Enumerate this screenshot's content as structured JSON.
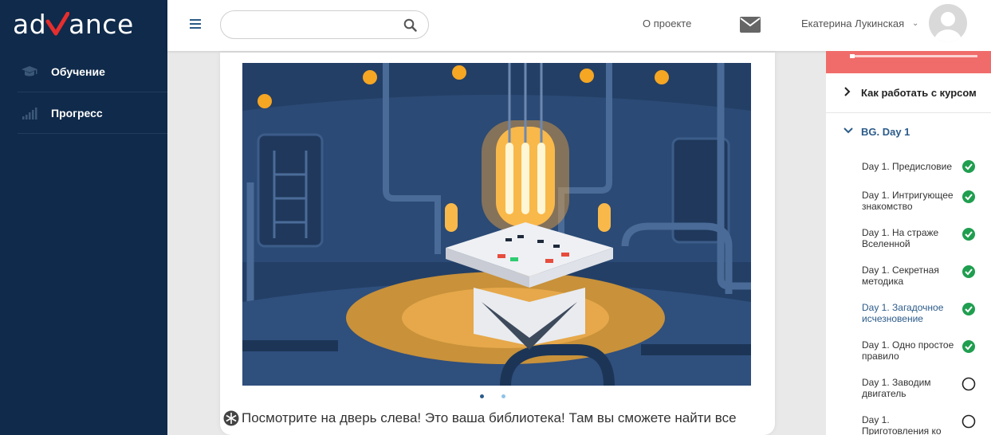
{
  "app": {
    "logo_left": "ad",
    "logo_right": "ance"
  },
  "sidebar": {
    "items": [
      {
        "label": "Обучение",
        "icon": "graduation-cap-icon"
      },
      {
        "label": "Прогресс",
        "icon": "bar-chart-icon"
      }
    ]
  },
  "header": {
    "search": {
      "placeholder": "",
      "value": ""
    },
    "about_label": "О проекте",
    "user_name": "Екатерина Лукинская"
  },
  "main": {
    "caption": "Посмотрите на дверь слева! Это ваша библиотека! Там вы сможете найти все",
    "carousel": {
      "total": 2,
      "active": 1
    }
  },
  "course": {
    "howto_label": "Как работать с курсом",
    "section_label": "BG. Day 1",
    "lessons": [
      {
        "line1": "Day 1. Предисловие",
        "line2": "",
        "done": true
      },
      {
        "line1": "Day 1. Интригующее",
        "line2": "знакомство",
        "done": true
      },
      {
        "line1": "Day 1. На страже",
        "line2": "Вселенной",
        "done": true
      },
      {
        "line1": "Day 1. Секретная",
        "line2": "методика",
        "done": true
      },
      {
        "line1": "Day 1. Загадочное",
        "line2": "исчезновение",
        "done": true,
        "current": true
      },
      {
        "line1": "Day 1. Одно простое",
        "line2": "правило",
        "done": true
      },
      {
        "line1": "Day 1. Заводим",
        "line2": "двигатель",
        "done": false
      },
      {
        "line1": "Day 1.",
        "line2": "Приготовления ко",
        "done": false
      }
    ]
  },
  "colors": {
    "sidebar_bg": "#0f2a4a",
    "accent_red": "#e52e2e",
    "progress_bar": "#f06c6a",
    "done_green": "#1f9e4f",
    "link_blue": "#2b5b8a"
  }
}
